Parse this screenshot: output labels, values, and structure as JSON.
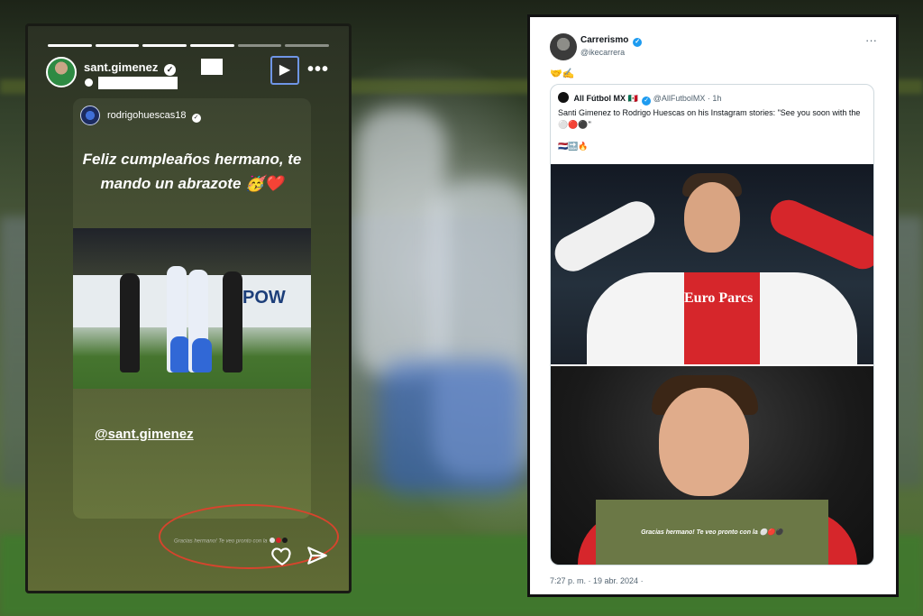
{
  "story": {
    "username": "sant.gimenez",
    "progress_total": 6,
    "progress_done": 4,
    "card": {
      "username": "rodrigohuescas18",
      "message": "Feliz cumpleaños hermano, te mando un abrazote 🥳❤️",
      "mention": "@sant.gimenez",
      "photo_banner_text": "POW"
    },
    "reply_text": "Gracias hermano! Te veo pronto con la",
    "reply_dot_colors": [
      "#e6e6e6",
      "#d6262b",
      "#1a1a1a"
    ]
  },
  "tweet": {
    "name": "Carrerismo",
    "handle": "@ikecarrera",
    "text": "🤝✍️",
    "quote": {
      "name": "All Fútbol MX 🇲🇽",
      "handle": "@AllFutbolMX",
      "time": "· 1h",
      "text": "Santi Gimenez to Rodrigo Huescas on his Instagram stories: \"See you soon with the ⚪🔴⚫\"",
      "extra": "🇳🇱🔜🔥",
      "shirt_text": "Euro Parcs",
      "overlay_text": "Gracias hermano! Te veo pronto con la ⚪🔴⚫"
    },
    "timestamp": "7:27 p. m. · 19 abr. 2024 ·"
  },
  "colors": {
    "verified_blue": "#1d9bf0",
    "highlight_red": "#d7442d",
    "feyenoord_red": "#d6262b"
  }
}
